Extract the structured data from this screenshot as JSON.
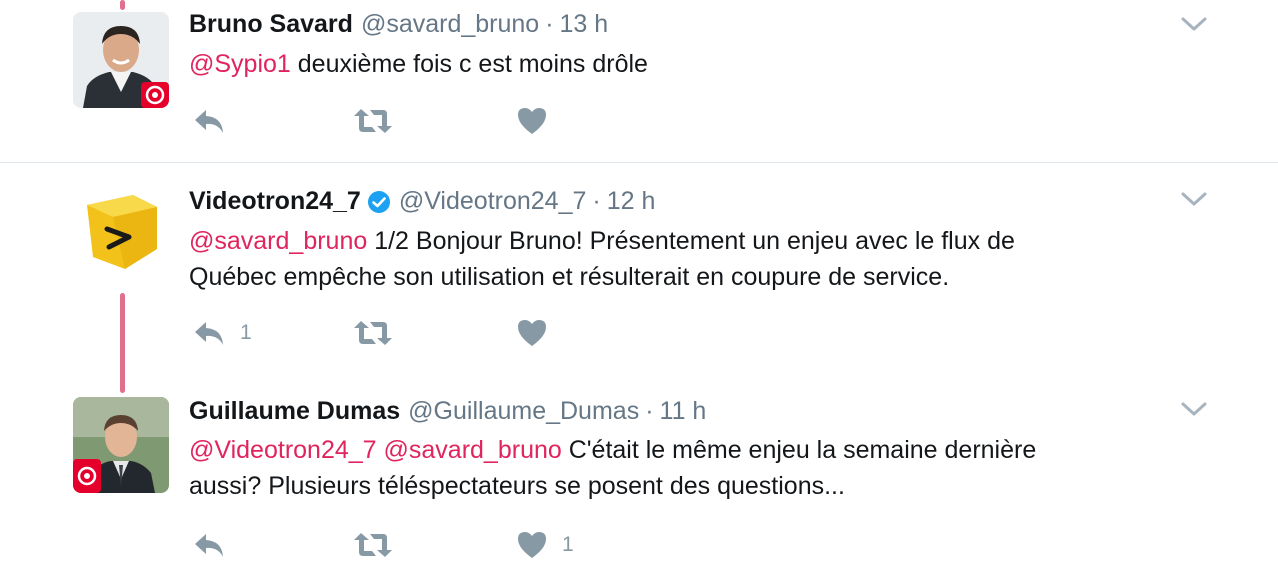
{
  "tweets": [
    {
      "name": "Bruno Savard",
      "handle": "@savard_bruno",
      "time": "13 h",
      "mention": "@Sypio1",
      "body": " deuxième fois c est moins drôle",
      "reply_count": "",
      "like_count": ""
    },
    {
      "name": "Videotron24_7",
      "handle": "@Videotron24_7",
      "time": "12 h",
      "verified": true,
      "mention": "@savard_bruno",
      "body_line1": " 1/2 Bonjour Bruno! Présentement un enjeu avec le flux de",
      "body_line2": "Québec empêche son utilisation et résulterait en coupure de service.",
      "reply_count": "1",
      "like_count": ""
    },
    {
      "name": "Guillaume Dumas",
      "handle": "@Guillaume_Dumas",
      "time": "11 h",
      "mention1": "@Videotron24_7",
      "mention2": "@savard_bruno",
      "body_line1": " C'était le même enjeu la semaine dernière",
      "body_line2": "aussi? Plusieurs téléspectateurs se posent des questions...",
      "reply_count": "",
      "like_count": "1"
    }
  ],
  "separator": "·",
  "colors": {
    "mention": "#e0245e",
    "secondary": "#657786",
    "action_icon": "#8899a6",
    "thread_line": "#e0708e",
    "verified": "#1da1f2"
  }
}
